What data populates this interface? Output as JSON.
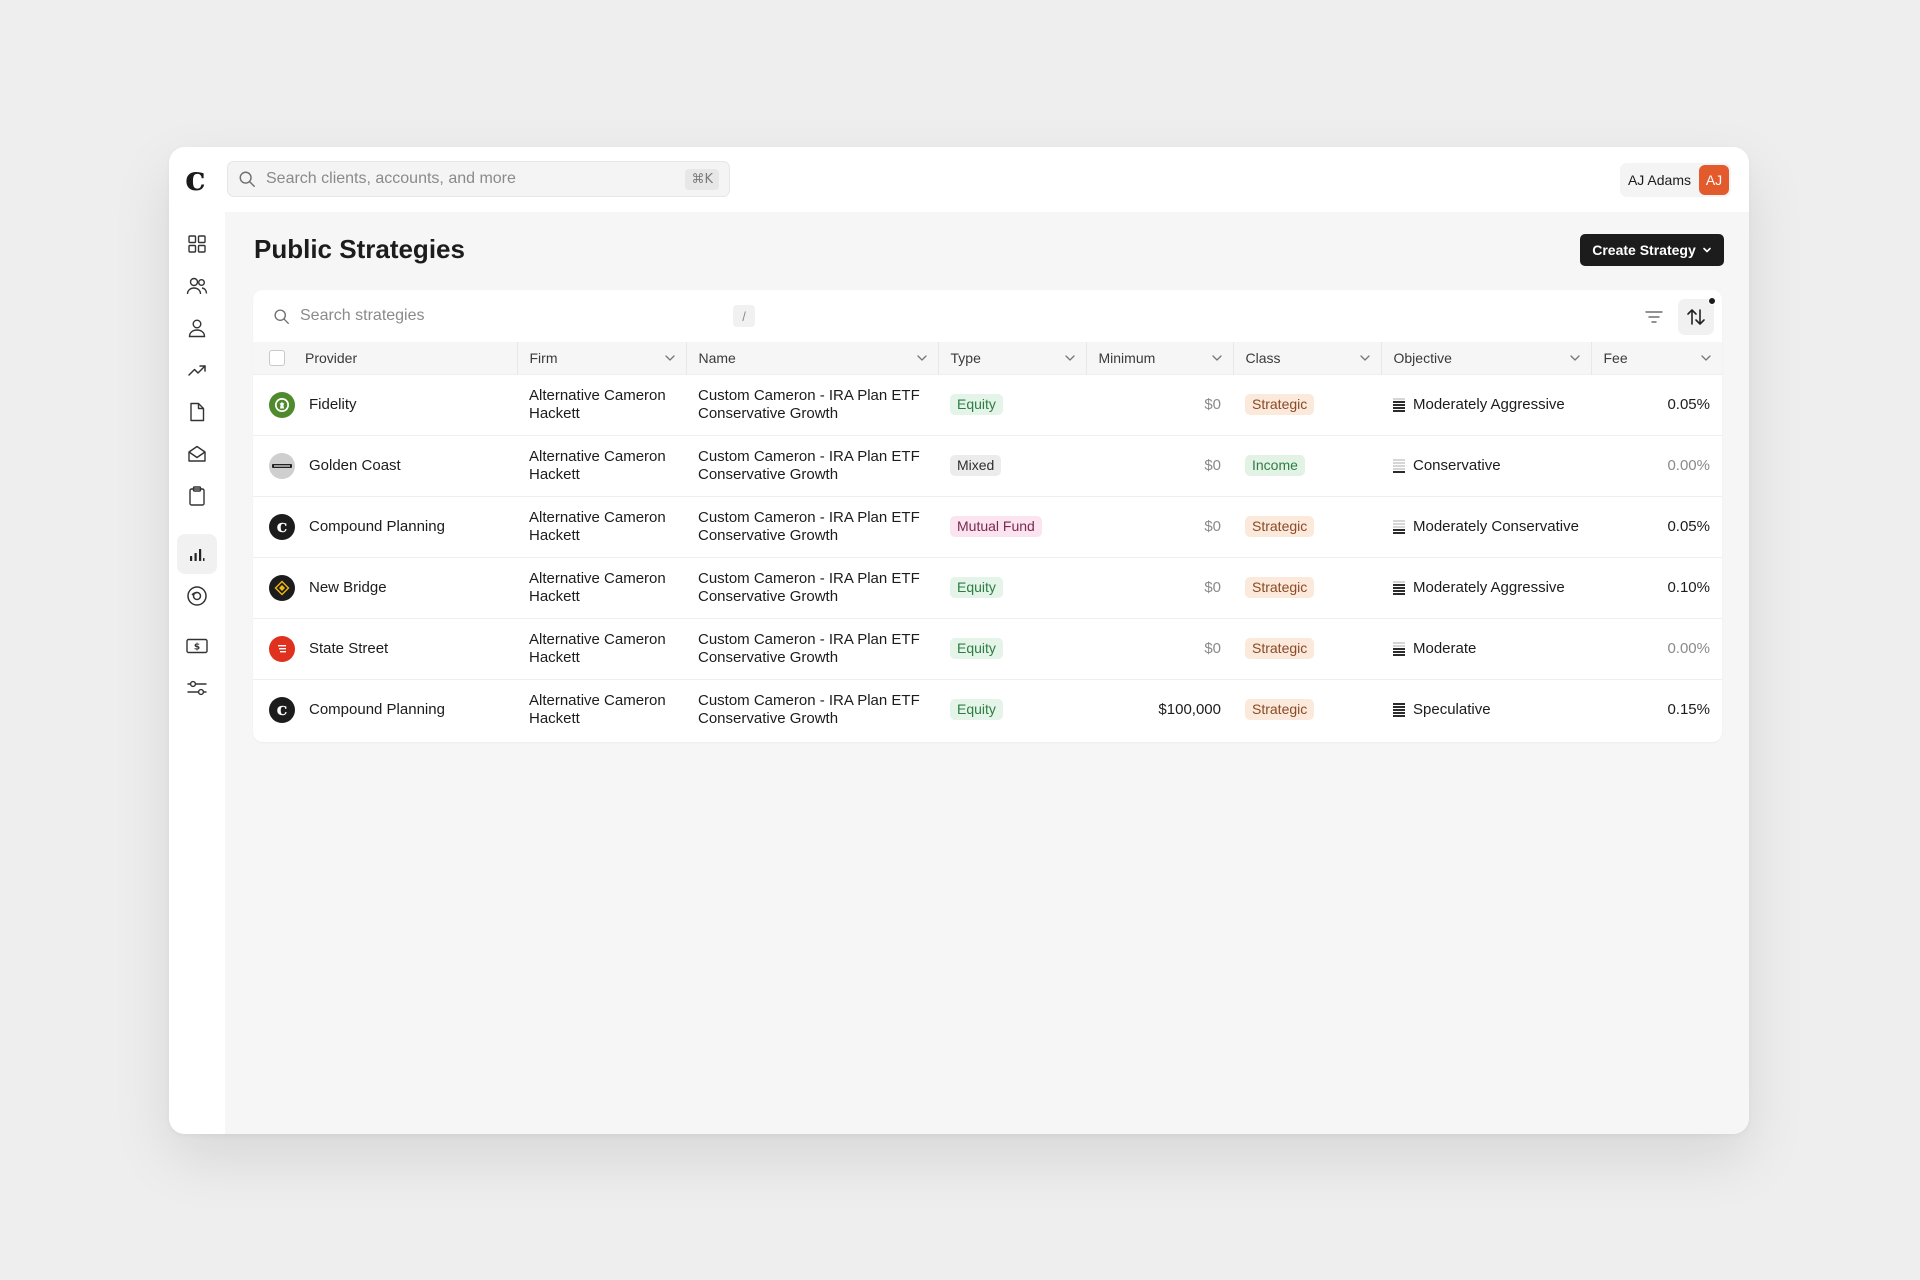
{
  "topbar": {
    "logo": "c",
    "search_placeholder": "Search clients, accounts, and more",
    "search_shortcut": "⌘K",
    "user_name": "AJ Adams",
    "user_initials": "AJ"
  },
  "sidebar": {
    "items": [
      {
        "icon": "dashboard-grid-icon"
      },
      {
        "icon": "households-icon"
      },
      {
        "icon": "client-icon"
      },
      {
        "icon": "trending-up-icon"
      },
      {
        "icon": "document-icon"
      },
      {
        "icon": "inbox-icon"
      },
      {
        "icon": "clipboard-icon"
      },
      {
        "icon": "bar-chart-icon",
        "active": true
      },
      {
        "icon": "target-icon"
      },
      {
        "icon": "billing-icon"
      },
      {
        "icon": "settings-sliders-icon"
      }
    ]
  },
  "page": {
    "title": "Public Strategies",
    "create_button": "Create Strategy"
  },
  "table_toolbar": {
    "search_placeholder": "Search strategies",
    "search_shortcut": "/"
  },
  "columns": {
    "provider": "Provider",
    "firm": "Firm",
    "name": "Name",
    "type": "Type",
    "minimum": "Minimum",
    "class": "Class",
    "objective": "Objective",
    "fee": "Fee"
  },
  "rows": [
    {
      "provider": "Fidelity",
      "firm": "Alternative Cameron Hackett",
      "name": "Custom Cameron - IRA Plan ETF Conservative Growth",
      "type": "Equity",
      "minimum": "$0",
      "class": "Strategic",
      "objective": "Moderately Aggressive",
      "objective_level": 4,
      "fee": "0.05%"
    },
    {
      "provider": "Golden Coast",
      "firm": "Alternative Cameron Hackett",
      "name": "Custom Cameron - IRA Plan ETF Conservative Growth",
      "type": "Mixed",
      "minimum": "$0",
      "class": "Income",
      "objective": "Conservative",
      "objective_level": 1,
      "fee": "0.00%"
    },
    {
      "provider": "Compound Planning",
      "firm": "Alternative Cameron Hackett",
      "name": "Custom Cameron - IRA Plan ETF Conservative Growth",
      "type": "Mutual Fund",
      "minimum": "$0",
      "class": "Strategic",
      "objective": "Moderately Conservative",
      "objective_level": 2,
      "fee": "0.05%"
    },
    {
      "provider": "New Bridge",
      "firm": "Alternative Cameron Hackett",
      "name": "Custom Cameron - IRA Plan ETF Conservative Growth",
      "type": "Equity",
      "minimum": "$0",
      "class": "Strategic",
      "objective": "Moderately Aggressive",
      "objective_level": 4,
      "fee": "0.10%"
    },
    {
      "provider": "State Street",
      "firm": "Alternative Cameron Hackett",
      "name": "Custom Cameron - IRA Plan ETF Conservative Growth",
      "type": "Equity",
      "minimum": "$0",
      "class": "Strategic",
      "objective": "Moderate",
      "objective_level": 3,
      "fee": "0.00%"
    },
    {
      "provider": "Compound Planning",
      "firm": "Alternative Cameron Hackett",
      "name": "Custom Cameron - IRA Plan ETF Conservative Growth",
      "type": "Equity",
      "minimum": "$100,000",
      "class": "Strategic",
      "objective": "Speculative",
      "objective_level": 5,
      "fee": "0.15%"
    }
  ],
  "colors": {
    "accent_dark": "#1c1c1c",
    "avatar": "#e35b2d",
    "fidelity": "#4f8a2c",
    "state_street": "#e0301e",
    "new_bridge": "#1c1c1c"
  }
}
